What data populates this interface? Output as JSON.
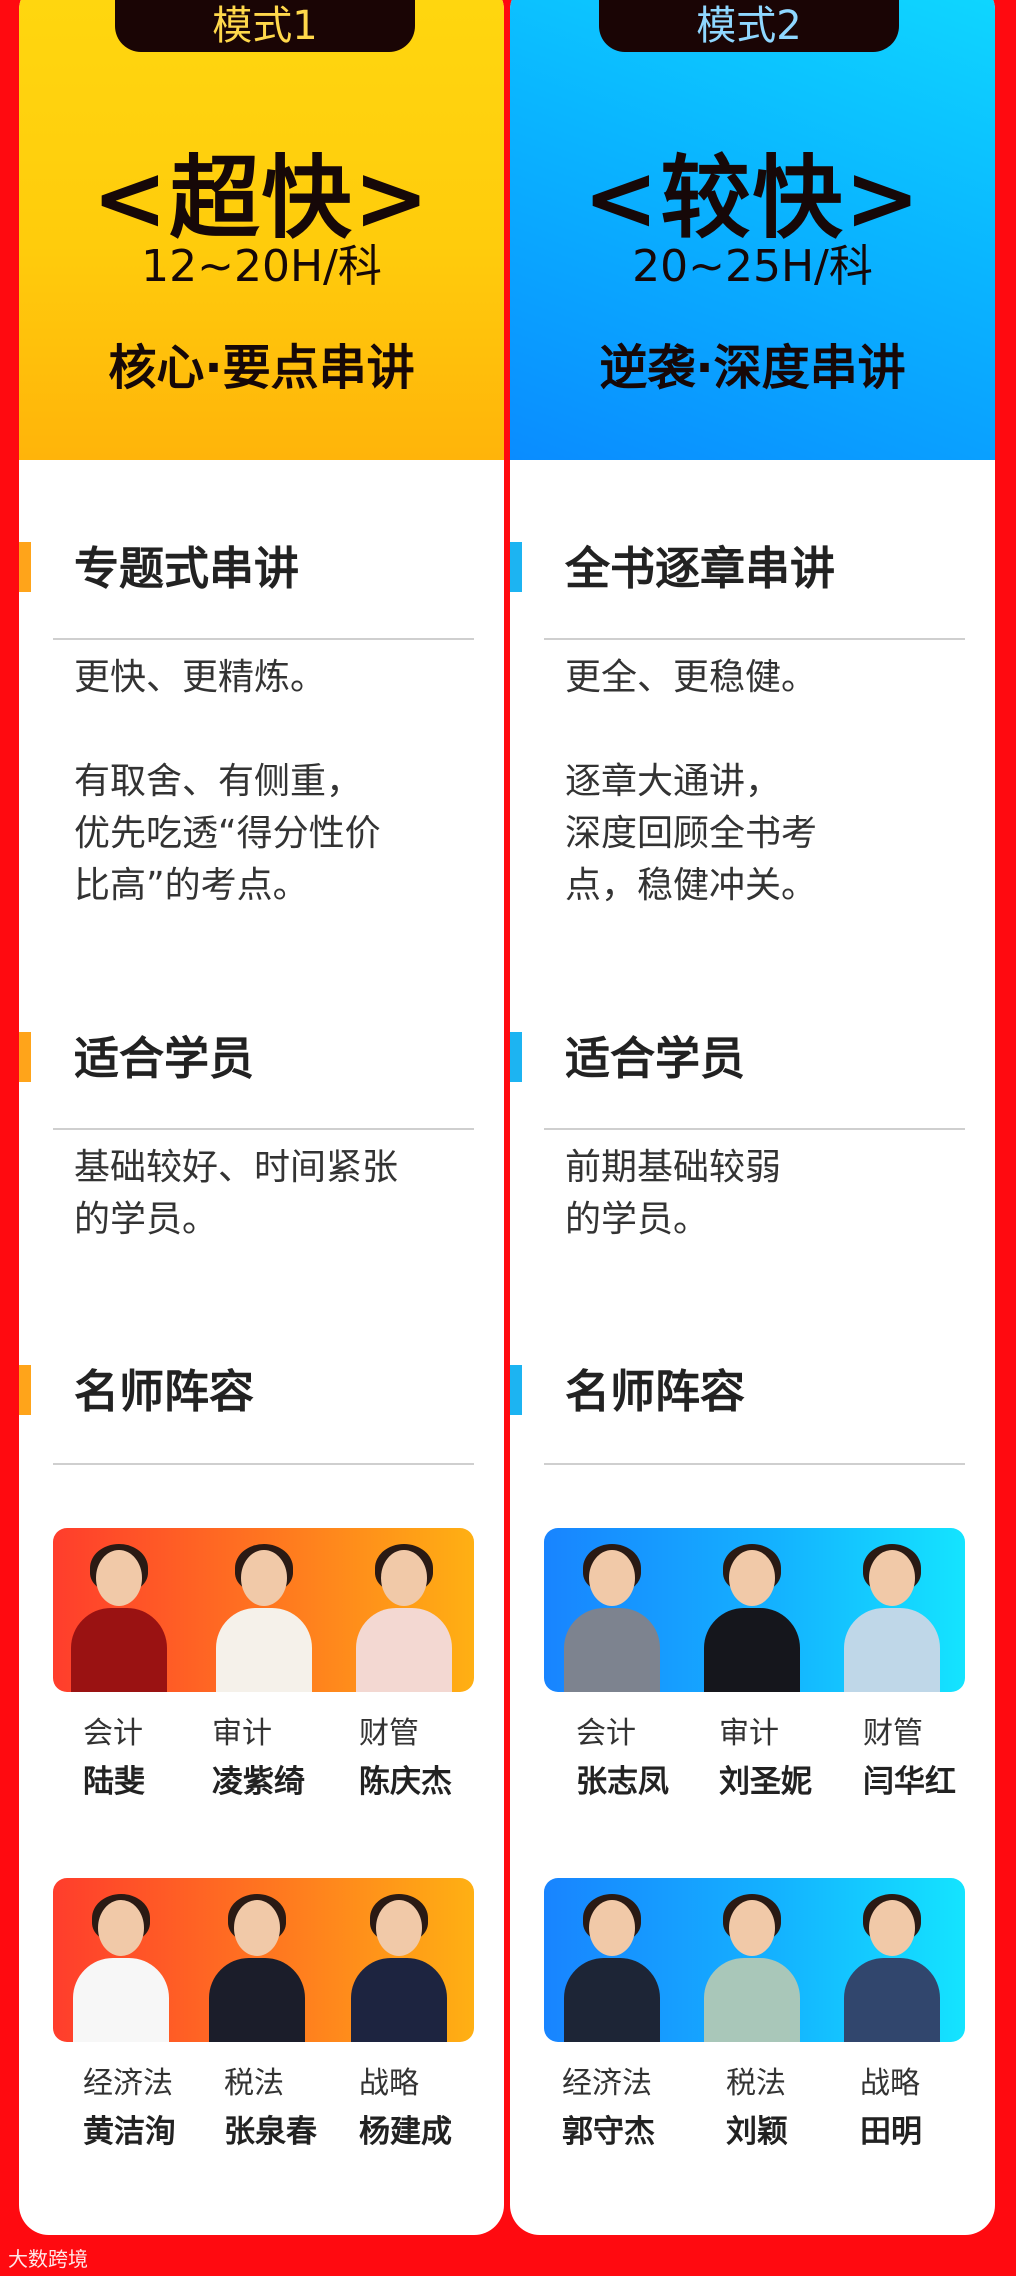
{
  "mode1": {
    "tab": "模式1",
    "speed": "<超快>",
    "hours": "12~20H/科",
    "tagline": "核心·要点串讲",
    "sections": [
      {
        "title": "专题式串讲",
        "text": "更快、更精炼。\n\n有取舍、有侧重，\n优先吃透“得分性价\n比高”的考点。"
      },
      {
        "title": "适合学员",
        "text": "基础较好、时间紧张\n的学员。"
      },
      {
        "title": "名师阵容"
      }
    ],
    "teachers_row1": [
      {
        "subject": "会计",
        "name": "陆斐"
      },
      {
        "subject": "审计",
        "name": "凌紫绮"
      },
      {
        "subject": "财管",
        "name": "陈庆杰"
      }
    ],
    "teachers_row2": [
      {
        "subject": "经济法",
        "name": "黄洁洵"
      },
      {
        "subject": "税法",
        "name": "张泉春"
      },
      {
        "subject": "战略",
        "name": "杨建成"
      }
    ]
  },
  "mode2": {
    "tab": "模式2",
    "speed": "<较快>",
    "hours": "20~25H/科",
    "tagline": "逆袭·深度串讲",
    "sections": [
      {
        "title": "全书逐章串讲",
        "text": "更全、更稳健。\n\n逐章大通讲，\n深度回顾全书考\n点，稳健冲关。"
      },
      {
        "title": "适合学员",
        "text": "前期基础较弱\n的学员。"
      },
      {
        "title": "名师阵容"
      }
    ],
    "teachers_row1": [
      {
        "subject": "会计",
        "name": "张志凤"
      },
      {
        "subject": "审计",
        "name": "刘圣妮"
      },
      {
        "subject": "财管",
        "name": "闫华红"
      }
    ],
    "teachers_row2": [
      {
        "subject": "经济法",
        "name": "郭守杰"
      },
      {
        "subject": "税法",
        "name": "刘颖"
      },
      {
        "subject": "战略",
        "name": "田明"
      }
    ]
  },
  "watermark": "大数跨境",
  "colors": {
    "background": "#ff0a10",
    "mode1_accent": "#ffa41a",
    "mode2_accent": "#1cb4f2"
  }
}
